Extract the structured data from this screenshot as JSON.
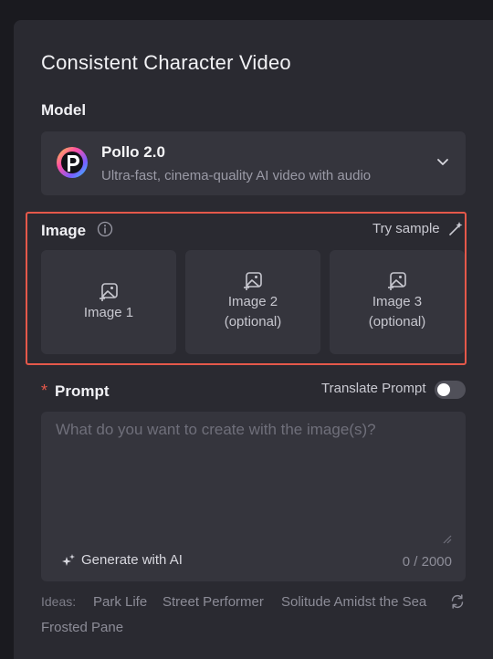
{
  "title": "Consistent Character Video",
  "model": {
    "label": "Model",
    "name": "Pollo 2.0",
    "description": "Ultra-fast, cinema-quality AI video with audio",
    "logo_icon": "pollo-logo-icon",
    "dropdown_icon": "chevron-down-icon"
  },
  "image": {
    "label": "Image",
    "try_sample": "Try sample",
    "slots": [
      {
        "line1": "Image 1",
        "line2": ""
      },
      {
        "line1": "Image 2",
        "line2": "(optional)"
      },
      {
        "line1": "Image 3",
        "line2": "(optional)"
      }
    ]
  },
  "prompt": {
    "required_mark": "*",
    "label": "Prompt",
    "translate_label": "Translate Prompt",
    "translate_on": false,
    "placeholder": "What do you want to create with the image(s)?",
    "value": "",
    "generate_label": "Generate with AI",
    "counter": "0 / 2000"
  },
  "ideas": {
    "label": "Ideas:",
    "items": [
      "Park Life",
      "Street Performer",
      "Solitude Amidst the Sea",
      "Frosted Pane"
    ]
  },
  "colors": {
    "highlight_border": "#e5584a",
    "panel_bg": "#2a2a31",
    "field_bg": "#35353d"
  }
}
